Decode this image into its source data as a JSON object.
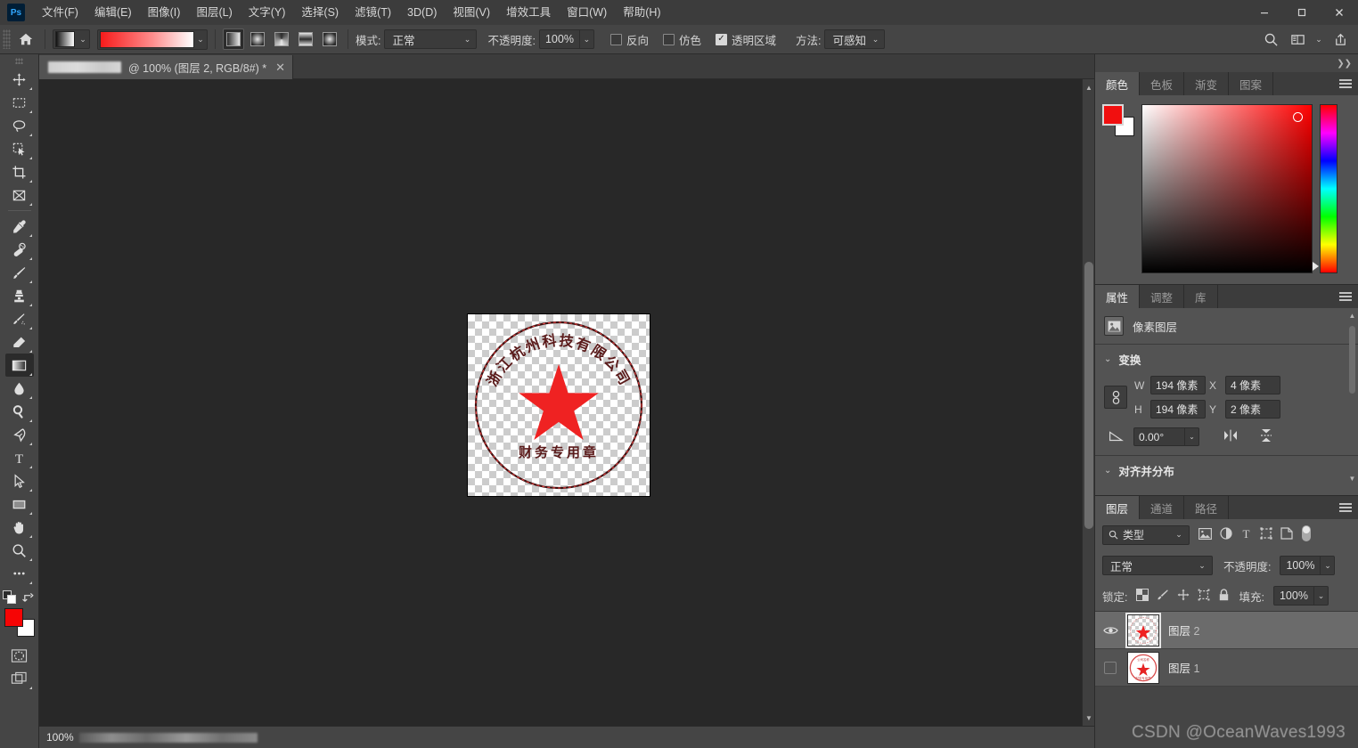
{
  "app": {
    "logo": "Ps",
    "theme_bg": "#535353",
    "accent": "#31a8ff",
    "foreground_color": "#f10f0f",
    "background_color": "#ffffff"
  },
  "menubar": {
    "items": [
      {
        "label": "文件(F)",
        "name": "menu-file"
      },
      {
        "label": "编辑(E)",
        "name": "menu-edit"
      },
      {
        "label": "图像(I)",
        "name": "menu-image"
      },
      {
        "label": "图层(L)",
        "name": "menu-layer"
      },
      {
        "label": "文字(Y)",
        "name": "menu-type"
      },
      {
        "label": "选择(S)",
        "name": "menu-select"
      },
      {
        "label": "滤镜(T)",
        "name": "menu-filter"
      },
      {
        "label": "3D(D)",
        "name": "menu-3d"
      },
      {
        "label": "视图(V)",
        "name": "menu-view"
      },
      {
        "label": "增效工具",
        "name": "menu-plugins"
      },
      {
        "label": "窗口(W)",
        "name": "menu-window"
      },
      {
        "label": "帮助(H)",
        "name": "menu-help"
      }
    ],
    "window_controls": {
      "minimize": "—",
      "maximize": "❐",
      "close": "✕"
    }
  },
  "options_bar": {
    "home_icon": "home-icon",
    "gradient_preset_icon": "gradient-thumbnail",
    "gradient_preview": "red-to-white-gradient",
    "gradient_types": [
      {
        "name": "linear-gradient-button",
        "active": true
      },
      {
        "name": "radial-gradient-button",
        "active": false
      },
      {
        "name": "angle-gradient-button",
        "active": false
      },
      {
        "name": "reflected-gradient-button",
        "active": false
      },
      {
        "name": "diamond-gradient-button",
        "active": false
      }
    ],
    "mode_label": "模式:",
    "mode_value": "正常",
    "opacity_label": "不透明度:",
    "opacity_value": "100%",
    "reverse_label": "反向",
    "reverse_checked": false,
    "dither_label": "仿色",
    "dither_checked": false,
    "transparency_label": "透明区域",
    "transparency_checked": true,
    "method_label": "方法:",
    "method_value": "可感知",
    "right_icons": [
      {
        "name": "search-icon"
      },
      {
        "name": "workspace-icon"
      },
      {
        "name": "chevron-down-icon"
      },
      {
        "name": "share-icon"
      }
    ]
  },
  "toolbar": {
    "tools": [
      {
        "name": "move-tool",
        "glyph": "move",
        "active": false
      },
      {
        "name": "rectangular-marquee-tool",
        "glyph": "marquee",
        "active": false
      },
      {
        "name": "lasso-tool",
        "glyph": "lasso",
        "active": false
      },
      {
        "name": "object-selection-tool",
        "glyph": "objsel",
        "active": false
      },
      {
        "name": "crop-tool",
        "glyph": "crop",
        "active": false
      },
      {
        "name": "frame-tool",
        "glyph": "frame",
        "active": false
      },
      {
        "name": "eyedropper-tool",
        "glyph": "eyedropper",
        "active": false
      },
      {
        "name": "spot-healing-brush-tool",
        "glyph": "healing",
        "active": false
      },
      {
        "name": "brush-tool",
        "glyph": "brush",
        "active": false
      },
      {
        "name": "clone-stamp-tool",
        "glyph": "stamp",
        "active": false
      },
      {
        "name": "history-brush-tool",
        "glyph": "historybrush",
        "active": false
      },
      {
        "name": "eraser-tool",
        "glyph": "eraser",
        "active": false
      },
      {
        "name": "gradient-tool",
        "glyph": "gradient",
        "active": true
      },
      {
        "name": "blur-tool",
        "glyph": "blur",
        "active": false
      },
      {
        "name": "dodge-tool",
        "glyph": "dodge",
        "active": false
      },
      {
        "name": "pen-tool",
        "glyph": "pen",
        "active": false
      },
      {
        "name": "horizontal-type-tool",
        "glyph": "type",
        "active": false
      },
      {
        "name": "path-selection-tool",
        "glyph": "pathsel",
        "active": false
      },
      {
        "name": "rectangle-tool",
        "glyph": "rectangle",
        "active": false
      },
      {
        "name": "hand-tool",
        "glyph": "hand",
        "active": false
      },
      {
        "name": "zoom-tool",
        "glyph": "zoom",
        "active": false
      },
      {
        "name": "edit-toolbar-button",
        "glyph": "ellipsis",
        "active": false
      }
    ],
    "default-colors-icon": "default-colors-icon",
    "swap-colors-icon": "swap-colors-icon",
    "quick-mask-icon": "quick-mask-icon",
    "screen-mode-icon": "screen-mode-icon"
  },
  "document": {
    "tab_name_redacted": true,
    "tab_title_suffix": "@ 100% (图层 2, RGB/8#) *",
    "close_icon": "✕",
    "zoom": "100%"
  },
  "canvas": {
    "artwork": "red-circular-seal-stamp-with-star",
    "background": "transparent-checkerboard"
  },
  "statusbar": {
    "zoom": "100%",
    "info_redacted": true
  },
  "color_panel": {
    "tabs": [
      {
        "label": "颜色",
        "active": true,
        "name": "tab-color"
      },
      {
        "label": "色板",
        "active": false,
        "name": "tab-swatches"
      },
      {
        "label": "渐变",
        "active": false,
        "name": "tab-gradients"
      },
      {
        "label": "图案",
        "active": false,
        "name": "tab-patterns"
      }
    ],
    "menu_icon": "panel-menu-icon",
    "foreground": "#f10f0f",
    "background": "#ffffff"
  },
  "properties_panel": {
    "tabs": [
      {
        "label": "属性",
        "active": true,
        "name": "tab-properties"
      },
      {
        "label": "调整",
        "active": false,
        "name": "tab-adjustments"
      },
      {
        "label": "库",
        "active": false,
        "name": "tab-libraries"
      }
    ],
    "menu_icon": "panel-menu-icon",
    "layer_kind_icon": "pixel-layer-icon",
    "layer_kind": "像素图层",
    "transform": {
      "section_label": "变换",
      "link_icon": "link-aspect-ratio-icon",
      "w_label": "W",
      "w_value": "194 像素",
      "x_label": "X",
      "x_value": "4 像素",
      "h_label": "H",
      "h_value": "194 像素",
      "y_label": "Y",
      "y_value": "2 像素",
      "angle_icon": "angle-icon",
      "angle_value": "0.00°",
      "flip_h_icon": "flip-horizontal-icon",
      "flip_v_icon": "flip-vertical-icon"
    },
    "align_section_label": "对齐并分布"
  },
  "layers_panel": {
    "tabs": [
      {
        "label": "图层",
        "active": true,
        "name": "tab-layers"
      },
      {
        "label": "通道",
        "active": false,
        "name": "tab-channels"
      },
      {
        "label": "路径",
        "active": false,
        "name": "tab-paths"
      }
    ],
    "menu_icon": "panel-menu-icon",
    "filter": {
      "search_icon": "search-icon",
      "value": "类型",
      "chevron": "chevron-down-icon",
      "type_icons": [
        {
          "name": "filter-pixel-icon"
        },
        {
          "name": "filter-adjustment-icon"
        },
        {
          "name": "filter-type-icon"
        },
        {
          "name": "filter-shape-icon"
        },
        {
          "name": "filter-smart-object-icon"
        }
      ],
      "toggle_icon": "filter-toggle-switch"
    },
    "blend_mode": "正常",
    "opacity_label": "不透明度:",
    "opacity_value": "100%",
    "lock_label": "锁定:",
    "lock_icons": [
      {
        "name": "lock-transparent-pixels-icon"
      },
      {
        "name": "lock-image-pixels-icon"
      },
      {
        "name": "lock-position-icon"
      },
      {
        "name": "lock-artboard-nesting-icon"
      },
      {
        "name": "lock-all-icon"
      }
    ],
    "fill_label": "填充:",
    "fill_value": "100%",
    "layers": [
      {
        "name": "图层",
        "number": "2",
        "visible": true,
        "selected": true,
        "thumbnail": "red-star-on-transparent"
      },
      {
        "name": "图层",
        "number": "1",
        "visible": false,
        "selected": false,
        "thumbnail": "red-seal-on-white"
      }
    ]
  },
  "watermark": {
    "text": "CSDN @OceanWaves1993"
  }
}
